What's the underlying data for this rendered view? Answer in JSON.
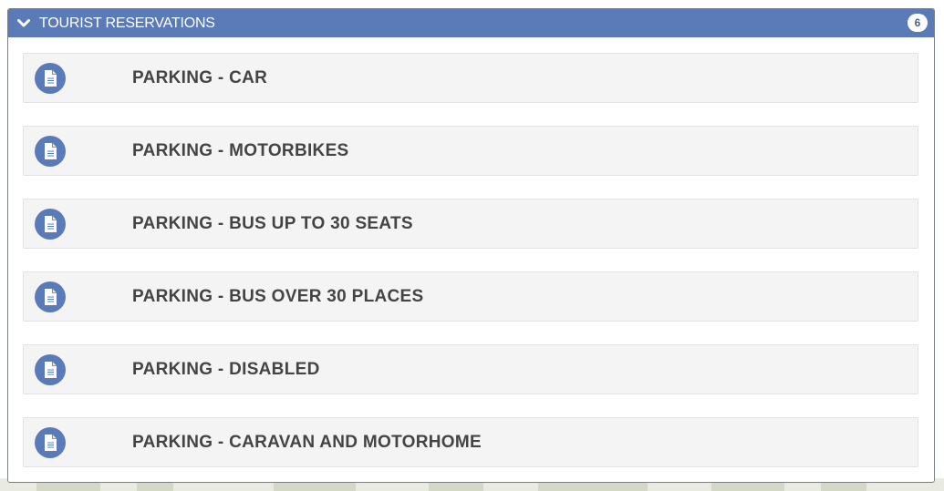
{
  "panel": {
    "title": "TOURIST RESERVATIONS",
    "count": "6",
    "header_color": "#5b7bb8",
    "icon": "chevron-down-icon"
  },
  "items": [
    {
      "label": "PARKING - CAR",
      "icon": "document-icon"
    },
    {
      "label": "PARKING - MOTORBIKES",
      "icon": "document-icon"
    },
    {
      "label": "PARKING - BUS UP TO 30 SEATS",
      "icon": "document-icon"
    },
    {
      "label": "PARKING - BUS OVER 30 PLACES",
      "icon": "document-icon"
    },
    {
      "label": "PARKING - DISABLED",
      "icon": "document-icon"
    },
    {
      "label": "PARKING - CARAVAN AND MOTORHOME",
      "icon": "document-icon"
    }
  ],
  "colors": {
    "icon_circle": "#5b7bb8",
    "item_background": "#f4f4f4",
    "label_text": "#444444"
  }
}
